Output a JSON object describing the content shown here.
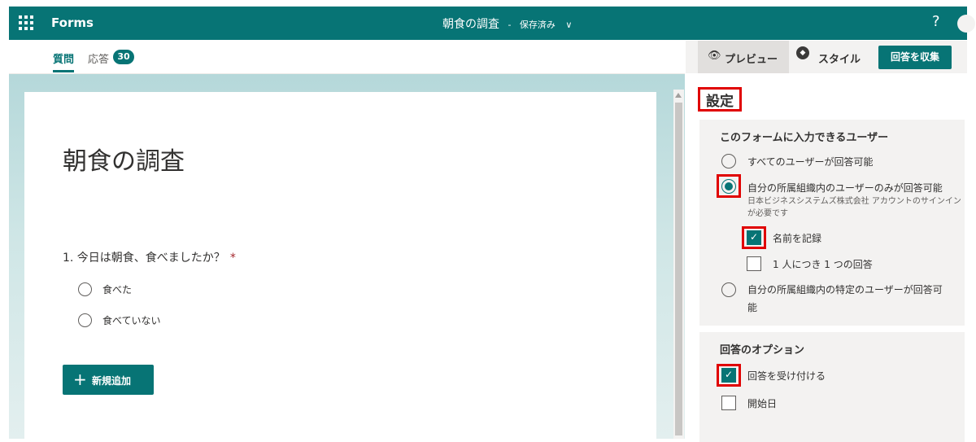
{
  "header": {
    "app_name": "Forms",
    "doc_title": "朝食の調査",
    "save_state": "保存済み",
    "save_separator": "-",
    "help": "?"
  },
  "tabs": {
    "questions": "質問",
    "responses": "応答",
    "response_count": "30"
  },
  "form": {
    "title": "朝食の調査",
    "question": "1. 今日は朝食、食べましたか？",
    "required_mark": "*",
    "options": [
      "食べた",
      "食べていない"
    ],
    "add_new": "新規追加"
  },
  "right_header": {
    "preview": "プレビュー",
    "style": "スタイル",
    "collect": "回答を収集"
  },
  "settings": {
    "title": "設定",
    "who_can_fill": {
      "title": "このフォームに入力できるユーザー",
      "anyone": "すべてのユーザーが回答可能",
      "org_only": "自分の所属組織内のユーザーのみが回答可能",
      "org_note": "日本ビジネスシステムズ株式会社 アカウントのサインインが必要です",
      "record_name": "名前を記録",
      "one_response": "1 人につき 1 つの回答",
      "specific_users": "自分の所属組織内の特定のユーザーが回答可能"
    },
    "response_options": {
      "title": "回答のオプション",
      "accept": "回答を受け付ける",
      "start_date": "開始日"
    }
  },
  "colors": {
    "brand": "#077475",
    "highlight_box": "#e00000"
  }
}
